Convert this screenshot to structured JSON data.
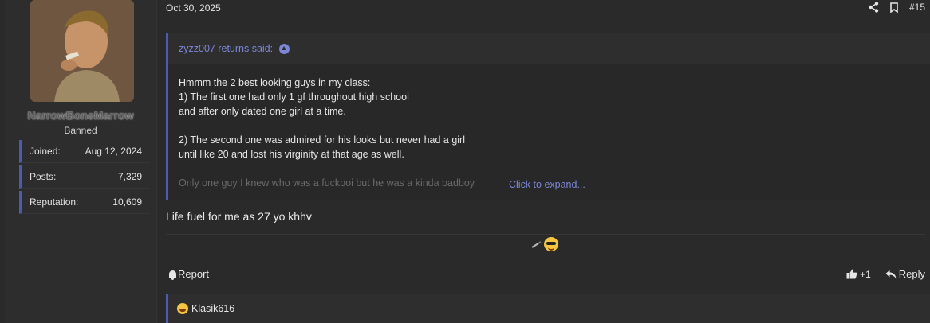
{
  "user": {
    "name": "NarrowBoneMarrow",
    "title": "Banned",
    "stats": [
      {
        "label": "Joined:",
        "value": "Aug 12, 2024"
      },
      {
        "label": "Posts:",
        "value": "7,329"
      },
      {
        "label": "Reputation:",
        "value": "10,609"
      }
    ]
  },
  "post": {
    "date": "Oct 30, 2025",
    "number": "#15",
    "quote": {
      "attribution": "zyzz007 returns said:",
      "lines": [
        "Hmmm the 2 best looking guys in my class:",
        "1) The first one had only 1 gf throughout high school",
        "and after only dated one girl at a time.",
        "",
        "2) The second one was admired for his looks but never had a girl",
        "until like 20 and lost his virginity at that age as well.",
        "",
        "Only one guy I knew who was a fuckboi but he was a kinda badboy"
      ],
      "expand_label": "Click to expand..."
    },
    "message": "Life fuel for me as 27 yo khhv",
    "actions": {
      "report": "Report",
      "like_count": "+1",
      "reply": "Reply"
    },
    "reactions": {
      "user": "Klasik616"
    }
  },
  "icons": {
    "share": "share-icon",
    "bookmark": "bookmark-icon",
    "bell": "bell-icon",
    "thumbs_up": "thumbs-up-icon",
    "reply": "reply-arrow-icon"
  }
}
